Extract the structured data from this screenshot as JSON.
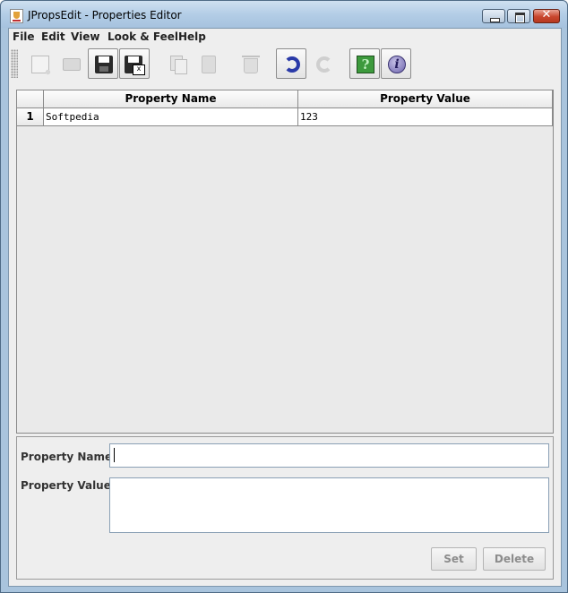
{
  "window": {
    "title": "JPropsEdit - Properties Editor",
    "close_glyph": "✕"
  },
  "menu": [
    {
      "label": "File"
    },
    {
      "label": "Edit"
    },
    {
      "label": "View"
    },
    {
      "label": "Look & Feel"
    },
    {
      "label": "Help"
    }
  ],
  "toolbar": {
    "items": [
      {
        "icon": "new-file-icon",
        "enabled": false
      },
      {
        "icon": "open-folder-icon",
        "enabled": false
      },
      {
        "icon": "save-icon",
        "enabled": true
      },
      {
        "icon": "save-as-icon",
        "enabled": true
      },
      {
        "icon": "copy-icon",
        "enabled": false
      },
      {
        "icon": "paste-icon",
        "enabled": false
      },
      {
        "icon": "delete-icon",
        "enabled": false
      },
      {
        "icon": "undo-icon",
        "enabled": true
      },
      {
        "icon": "redo-icon",
        "enabled": false
      },
      {
        "icon": "help-icon",
        "enabled": true,
        "glyph": "?"
      },
      {
        "icon": "info-icon",
        "enabled": true,
        "glyph": "i"
      }
    ]
  },
  "table": {
    "columns": [
      "Property Name",
      "Property Value"
    ],
    "rows": [
      {
        "index": "1",
        "name": "Softpedia",
        "value": "123"
      }
    ]
  },
  "editor": {
    "name_label": "Property Name:",
    "name_value": "",
    "value_label": "Property Value:",
    "value_value": "",
    "set_label": "Set",
    "delete_label": "Delete"
  },
  "colors": {
    "title_bar": "#b3cde6",
    "client_bg": "#eeeeee",
    "close_button": "#c8452d"
  }
}
